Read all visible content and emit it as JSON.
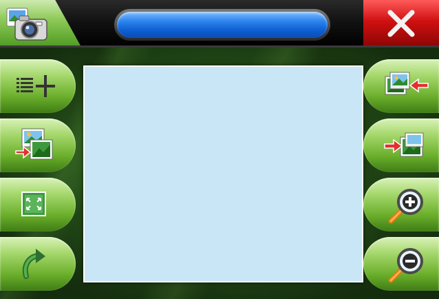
{
  "window": {
    "title": "",
    "app_icon": "camera-photo-icon",
    "close_icon": "close-icon"
  },
  "left_toolbar": [
    {
      "id": "add-to-list",
      "icon": "list-add-icon"
    },
    {
      "id": "import-picture",
      "icon": "picture-import-icon"
    },
    {
      "id": "fit-screen",
      "icon": "fit-screen-icon"
    },
    {
      "id": "rotate",
      "icon": "rotate-icon"
    }
  ],
  "right_toolbar": [
    {
      "id": "previous-picture",
      "icon": "picture-arrow-left-icon"
    },
    {
      "id": "next-picture",
      "icon": "picture-arrow-right-icon"
    },
    {
      "id": "zoom-in",
      "icon": "zoom-in-icon"
    },
    {
      "id": "zoom-out",
      "icon": "zoom-out-icon"
    }
  ],
  "preview": {
    "content": ""
  },
  "colors": {
    "accent_green": "#6aae2b",
    "title_blue": "#0e5fd2",
    "close_red": "#d01010",
    "preview_background": "#c8e6f6"
  }
}
